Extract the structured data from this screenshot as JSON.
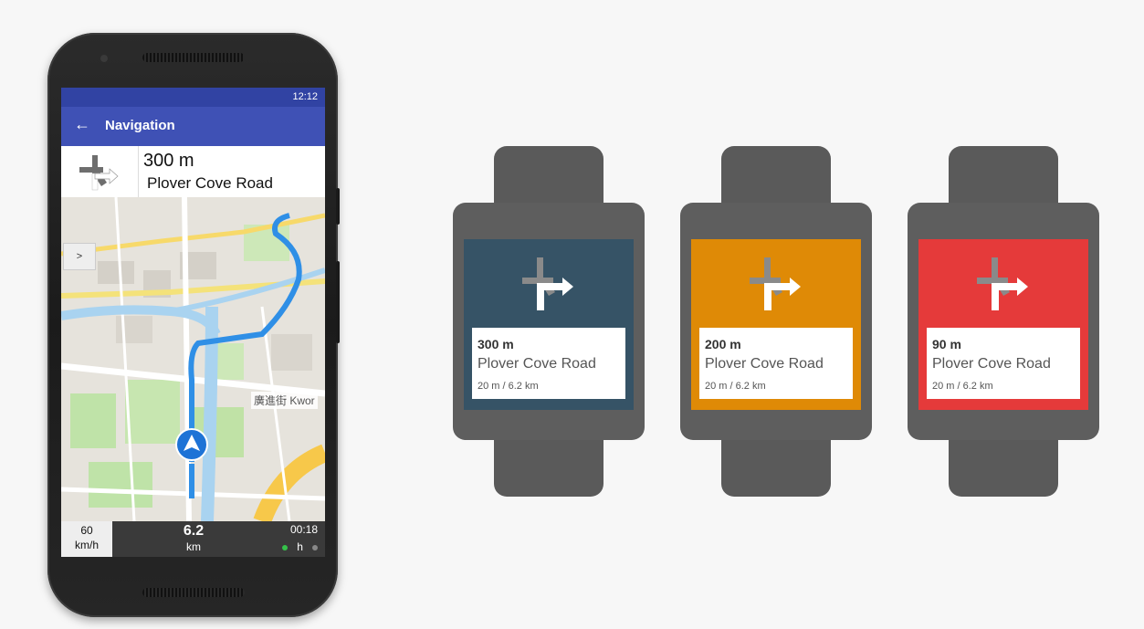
{
  "phone": {
    "status_time": "12:12",
    "app_title": "Navigation",
    "instruction": {
      "distance": "300 m",
      "road": "Plover Cove Road"
    },
    "map": {
      "toggle_label": ">",
      "poi_label": "廣進街 Kwor"
    },
    "bottom": {
      "speed_value": "60",
      "speed_unit": "km/h",
      "distance_value": "6.2",
      "distance_unit": "km",
      "time_value": "00:18",
      "time_unit": "h"
    }
  },
  "watches": [
    {
      "distance": "300 m",
      "road": "Plover Cove Road",
      "sub": "20 m / 6.2 km",
      "color": "#365366"
    },
    {
      "distance": "200 m",
      "road": "Plover Cove Road",
      "sub": "20 m / 6.2 km",
      "color": "#df8a06"
    },
    {
      "distance": "90 m",
      "road": "Plover Cove Road",
      "sub": "20 m / 6.2 km",
      "color": "#e53a3a"
    }
  ],
  "icons": {
    "back": "arrow-left-icon",
    "turn": "turn-right-icon",
    "nav": "navigation-arrow-icon"
  },
  "colors": {
    "statusbar": "#3143a3",
    "appbar": "#3f51b5",
    "route": "#2f8fe6",
    "gps_on": "#35c24a",
    "gps_off": "#888888"
  }
}
